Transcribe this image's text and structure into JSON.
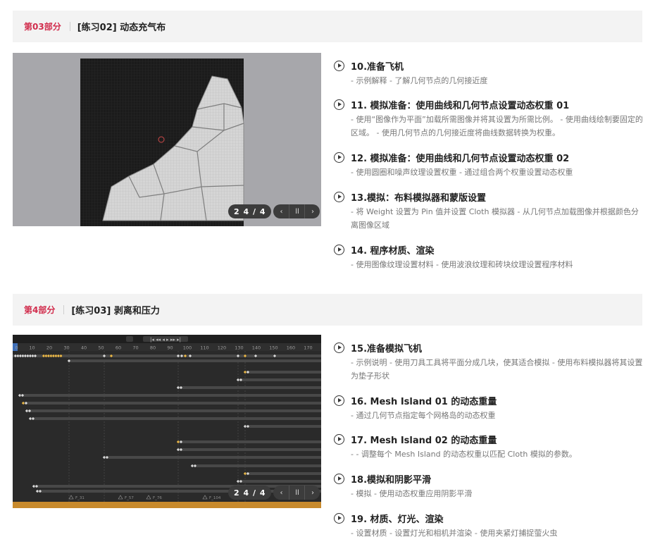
{
  "sections": [
    {
      "part": "第03部分",
      "title": "[练习02] 动态充气布",
      "pager": {
        "count": "2 4 / 4",
        "prev": "‹",
        "pause": "ll",
        "next": "›"
      },
      "lessons": [
        {
          "title": "10.准备飞机",
          "desc": "- 示例解释 - 了解几何节点的几何接近度"
        },
        {
          "title": "11. 模拟准备：使用曲线和几何节点设置动态权重 01",
          "desc": "- 使用“图像作为平面”加载所需图像并将其设置为所需比例。 - 使用曲线绘制要固定的区域。 - 使用几何节点的几何接近度将曲线数据转换为权重。"
        },
        {
          "title": "12. 模拟准备：使用曲线和几何节点设置动态权重 02",
          "desc": "- 使用圆圈和噪声纹理设置权重 - 通过组合两个权重设置动态权重"
        },
        {
          "title": "13.模拟：布料模拟器和蒙版设置",
          "desc": "- 将 Weight 设置为 Pin 值并设置 Cloth 模拟器 - 从几何节点加载图像并根据颜色分离图像区域"
        },
        {
          "title": "14. 程序材质、渲染",
          "desc": "- 使用图像纹理设置材料 - 使用波浪纹理和砖块纹理设置程序材料"
        }
      ]
    },
    {
      "part": "第4部分",
      "title": "[练习03] 剥离和压力",
      "pager": {
        "count": "2 4 / 4",
        "prev": "‹",
        "pause": "ll",
        "next": "›"
      },
      "lessons": [
        {
          "title": "15.准备模拟飞机",
          "desc": "- 示例说明 - 使用刀具工具将平面分成几块，使其适合模拟 - 使用布料模拟器将其设置为垫子形状"
        },
        {
          "title": "16. Mesh Island 01 的动态重量",
          "desc": "- 通过几何节点指定每个网格岛的动态权重"
        },
        {
          "title": "17. Mesh Island 02 的动态重量",
          "desc": "- - 调整每个 Mesh Island 的动态权重以匹配 Cloth 模拟的参数。"
        },
        {
          "title": "18.模拟和阴影平滑",
          "desc": "- 模拟 - 使用动态权重应用阴影平滑"
        },
        {
          "title": "19. 材质、灯光、渲染",
          "desc": "- 设置材质 - 设置灯光和相机并渲染 - 使用夹紧灯捕捉萤火虫"
        }
      ]
    }
  ],
  "timeline": {
    "ruler": [
      "0",
      "10",
      "20",
      "30",
      "40",
      "50",
      "60",
      "70",
      "80",
      "90",
      "100",
      "110",
      "120",
      "130",
      "140",
      "150",
      "160",
      "170"
    ],
    "markers": [
      "F_31",
      "F_57",
      "F_76",
      "F_104"
    ]
  }
}
